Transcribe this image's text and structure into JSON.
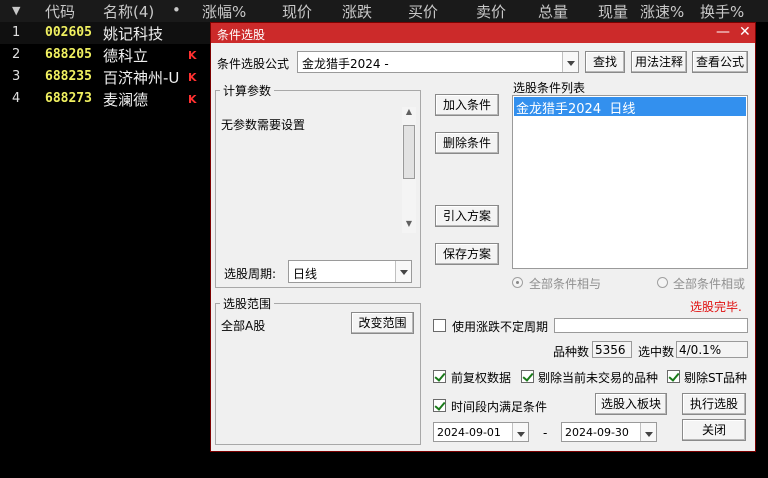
{
  "list_header": {
    "arrow": "▼",
    "code": "代码",
    "name": "名称(4)",
    "dot": "•",
    "change_pct": "涨幅%",
    "price": "现价",
    "change": "涨跌",
    "bid": "买价",
    "ask": "卖价",
    "volume": "总量",
    "current_vol": "现量",
    "speed": "涨速%",
    "turnover": "换手%"
  },
  "stocks": [
    {
      "idx": "1",
      "code": "002605",
      "name": "姚记科技",
      "k": ""
    },
    {
      "idx": "2",
      "code": "688205",
      "name": "德科立",
      "k": "K"
    },
    {
      "idx": "3",
      "code": "688235",
      "name": "百济神州-U",
      "k": "K"
    },
    {
      "idx": "4",
      "code": "688273",
      "name": "麦澜德",
      "k": "K"
    }
  ],
  "dialog": {
    "title": "条件选股",
    "minimize": "—",
    "close": "✕",
    "formula_label": "条件选股公式",
    "formula_value": "金龙猎手2024 -",
    "find_btn": "查找",
    "usage_btn": "用法注释",
    "view_btn": "查看公式",
    "params_group": "计算参数",
    "params_text": "无参数需要设置",
    "period_label": "选股周期:",
    "period_value": "日线",
    "add_btn": "加入条件",
    "delete_btn": "删除条件",
    "import_btn": "引入方案",
    "save_btn": "保存方案",
    "cond_list_label": "选股条件列表",
    "cond_item": "金龙猎手2024  日线",
    "radio_and": "全部条件相与",
    "radio_or": "全部条件相或",
    "status": "选股完毕.",
    "scope_group": "选股范围",
    "scope_value": "全部A股",
    "change_scope_btn": "改变范围",
    "use_unfixed_label": "使用涨跌不定周期",
    "count_label": "品种数",
    "count_value": "5356",
    "selected_label": "选中数",
    "selected_value": "4/0.1%",
    "fq_label": "前复权数据",
    "exclude_untraded_label": "剔除当前未交易的品种",
    "exclude_st_label": "剔除ST品种",
    "period_cond_label": "时间段内满足条件",
    "to_block_btn": "选股入板块",
    "execute_btn": "执行选股",
    "date_from": "2024-09-01",
    "date_sep": "-",
    "date_to": "2024-09-30",
    "close_btn": "关闭"
  }
}
